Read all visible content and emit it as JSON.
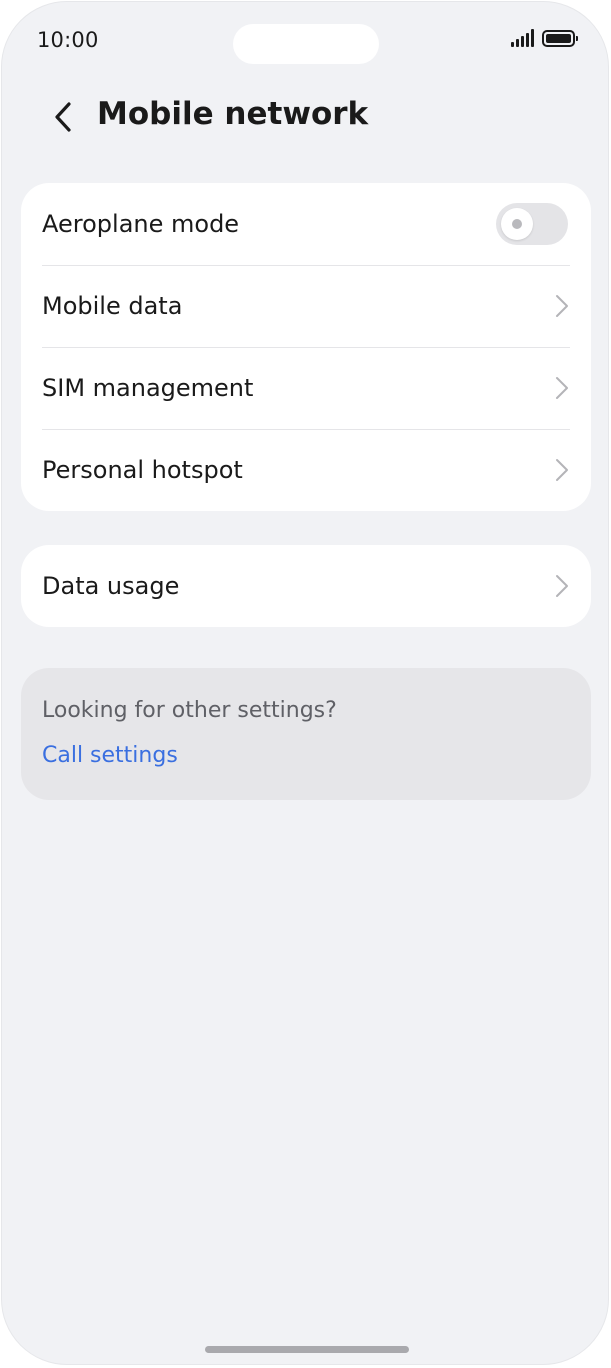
{
  "status_bar": {
    "time": "10:00",
    "signal_icon": "signal-icon",
    "battery_icon": "battery-icon"
  },
  "header": {
    "back_icon": "chevron-left-icon",
    "title": "Mobile network"
  },
  "settings_group": {
    "items": [
      {
        "label": "Aeroplane mode",
        "control": "toggle",
        "enabled": false
      },
      {
        "label": "Mobile data",
        "control": "chevron-right-icon"
      },
      {
        "label": "SIM management",
        "control": "chevron-right-icon"
      },
      {
        "label": "Personal hotspot",
        "control": "chevron-right-icon"
      }
    ]
  },
  "usage_group": {
    "items": [
      {
        "label": "Data usage",
        "control": "chevron-right-icon"
      }
    ]
  },
  "suggestions": {
    "prompt": "Looking for other settings?",
    "link": "Call settings"
  },
  "colors": {
    "background": "#f1f2f5",
    "card": "#ffffff",
    "text": "#1a1a1a",
    "link": "#3a6fe0",
    "toggle_off": "#e4e4e7",
    "suggestion_card": "#e6e6e9"
  }
}
